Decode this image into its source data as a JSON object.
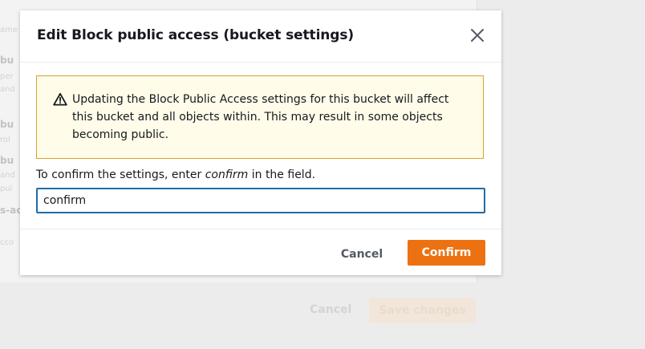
{
  "background": {
    "fragments": [
      {
        "text": "ame",
        "light": true
      },
      {
        "text": "bu",
        "light": false
      },
      {
        "text": "per",
        "light": true
      },
      {
        "text": "and",
        "light": true
      },
      {
        "text": "bu",
        "light": false
      },
      {
        "text": "rol",
        "light": true
      },
      {
        "text": "bu",
        "light": false
      },
      {
        "text": "and",
        "light": true
      },
      {
        "text": "pul",
        "light": true
      },
      {
        "text": "s-ac",
        "light": false
      },
      {
        "text": "cco",
        "light": true
      }
    ],
    "cancel_label": "Cancel",
    "save_label": "Save changes"
  },
  "modal": {
    "title": "Edit Block public access (bucket settings)",
    "close_icon": "close-icon",
    "alert": {
      "icon": "warning-icon",
      "text": "Updating the Block Public Access settings for this bucket will affect this bucket and all objects within. This may result in some objects becoming public."
    },
    "confirm_label_prefix": "To confirm the settings, enter ",
    "confirm_label_emphasis": "confirm",
    "confirm_label_suffix": " in the field.",
    "input_value": "confirm",
    "cancel_label": "Cancel",
    "confirm_label": "Confirm"
  },
  "colors": {
    "accent": "#ec7211",
    "input_border": "#1e6ea8",
    "alert_border": "#d8a233",
    "alert_bg": "#fffce9"
  }
}
